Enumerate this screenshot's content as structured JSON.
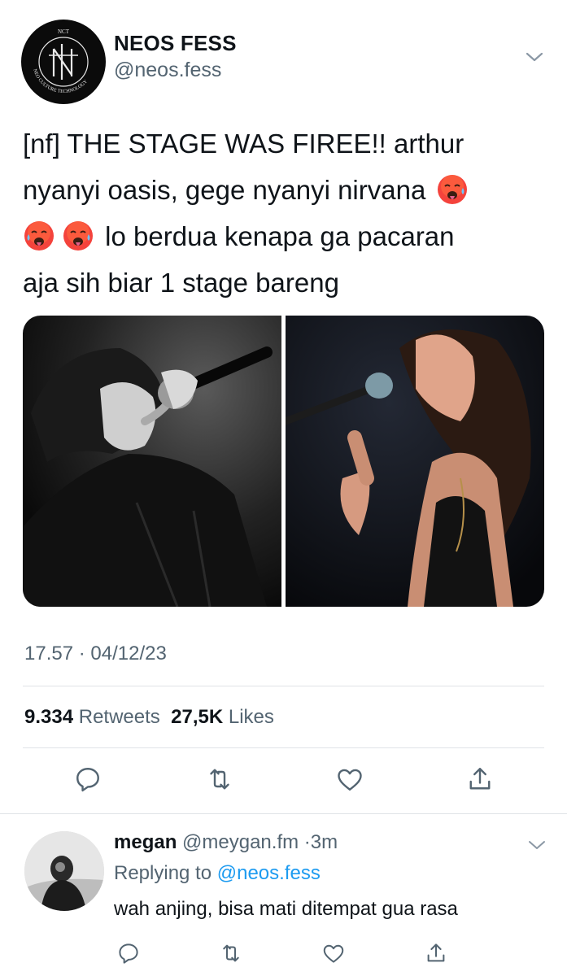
{
  "tweet": {
    "display_name": "NEOS FESS",
    "handle": "@neos.fess",
    "avatar_text": {
      "top": "NCT",
      "ring": "NEO CULTURE TECHNOLOGY"
    },
    "text_line1": "[nf] THE STAGE WAS FIREE!! arthur",
    "text_line2": "nyanyi oasis, gege nyanyi nirvana",
    "text_line3": "lo berdua kenapa ga pacaran",
    "text_line4": "aja sih biar 1 stage bareng",
    "emoji_name": "hot-face-emoji",
    "timestamp": "17.57 · 04/12/23",
    "retweets_count": "9.334",
    "retweets_label": "Retweets",
    "likes_count": "27,5K",
    "likes_label": "Likes",
    "actions": [
      "reply-icon",
      "retweet-icon",
      "like-icon",
      "share-icon"
    ]
  },
  "reply": {
    "name": "megan",
    "handle": "@meygan.fm",
    "separator": "·",
    "time": "3m",
    "replying_label": "Replying to",
    "replying_handle": "@neos.fess",
    "text": "wah anjing, bisa mati ditempat gua rasa",
    "actions": [
      "reply-icon",
      "retweet-icon",
      "like-icon",
      "share-icon"
    ]
  },
  "colors": {
    "text_primary": "#0f1419",
    "text_secondary": "#536471",
    "link": "#1d9bf0",
    "divider": "#dfe3e7",
    "icon": "#536471"
  }
}
